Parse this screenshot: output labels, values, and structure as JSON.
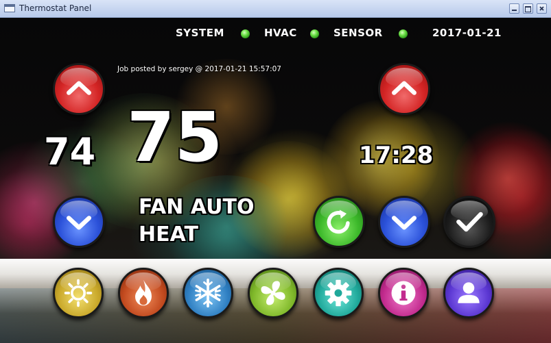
{
  "window": {
    "title": "Thermostat Panel",
    "min_label": "_",
    "max_label": "□",
    "close_label": "×"
  },
  "status": {
    "items": [
      {
        "label": "SYSTEM",
        "indicator": "green"
      },
      {
        "label": "HVAC",
        "indicator": "green"
      },
      {
        "label": "SENSOR",
        "indicator": "green"
      }
    ],
    "date": "2017-01-21"
  },
  "posted": "Job posted by sergey @ 2017-01-21 15:57:07",
  "thermostat": {
    "current_temp": "74",
    "set_temp": "75",
    "clock": "17:28",
    "fan_mode": "FAN AUTO",
    "hvac_mode": "HEAT"
  },
  "controls": {
    "temp_up_icon": "chevron-up-icon",
    "temp_down_icon": "chevron-down-icon",
    "time_up_icon": "chevron-up-icon",
    "time_down_icon": "chevron-down-icon",
    "refresh_icon": "refresh-icon",
    "confirm_icon": "checkmark-icon"
  },
  "modes": [
    {
      "icon": "auto-heat-cool-icon",
      "color": "#c9a82a"
    },
    {
      "icon": "flame-icon",
      "color": "#c24a1f"
    },
    {
      "icon": "snowflake-icon",
      "color": "#2f7fc2"
    },
    {
      "icon": "fan-icon",
      "color": "#7fb82a"
    },
    {
      "icon": "gear-icon",
      "color": "#1fa89a"
    },
    {
      "icon": "info-icon",
      "color": "#c22b8e"
    },
    {
      "icon": "user-icon",
      "color": "#5a36d1"
    }
  ]
}
